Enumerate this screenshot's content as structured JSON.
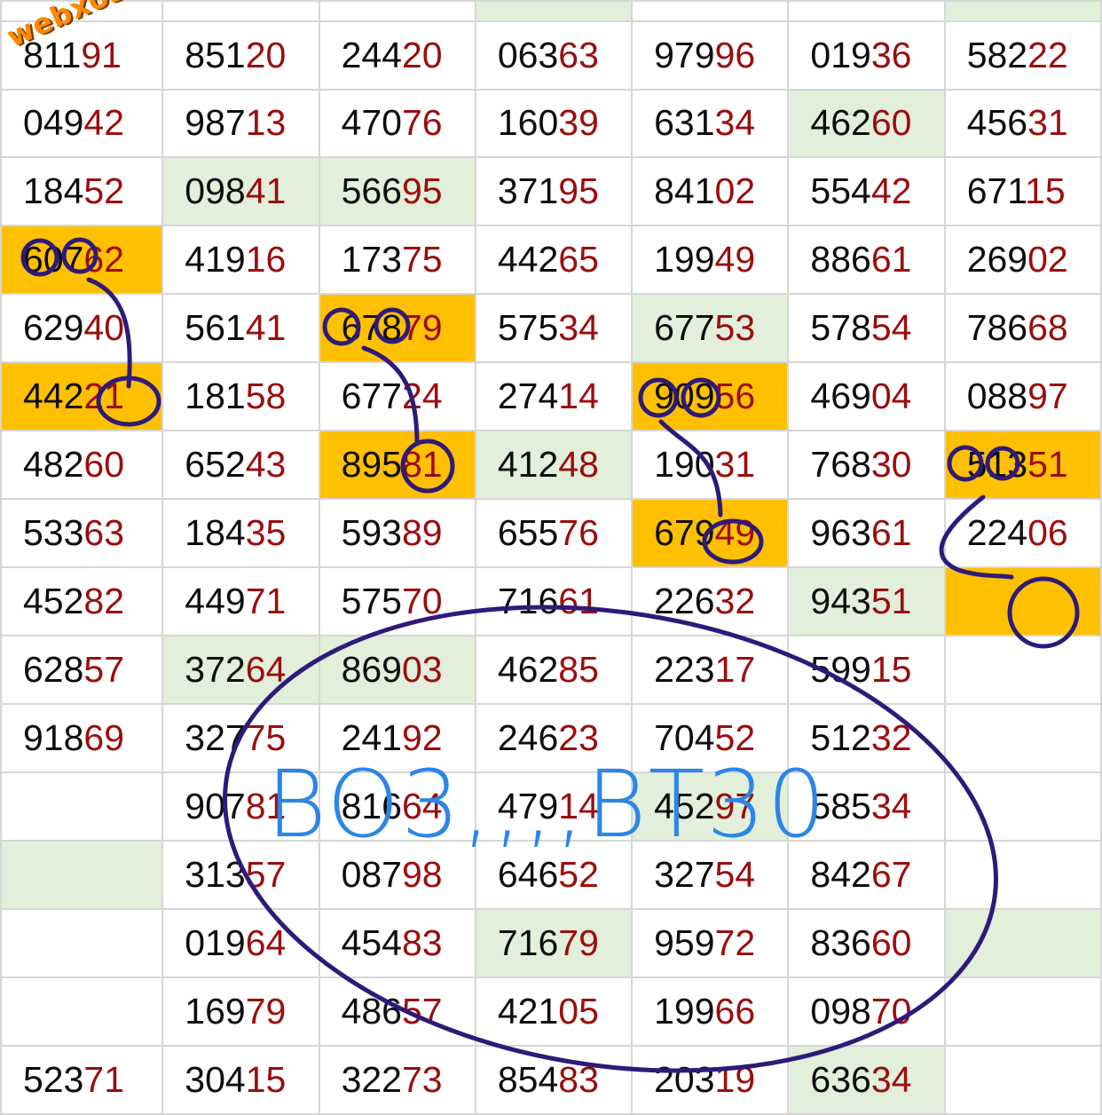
{
  "watermark": "webxoso.net",
  "handwritten_note": "BO3,,,,BT30",
  "colors": {
    "grid_line": "#d6d6d6",
    "digit_dark": "#0d0d0d",
    "digit_red": "#9b0d0d",
    "highlight_green": "#e2efda",
    "highlight_orange": "#ffc000",
    "ink": "#2e1a7a",
    "note_blue": "#2b86e8",
    "watermark": "#ff8a00"
  },
  "rows": [
    [
      {
        "v": "81191"
      },
      {
        "v": "85120"
      },
      {
        "v": "24420"
      },
      {
        "v": "06363"
      },
      {
        "v": "97996"
      },
      {
        "v": "01936"
      },
      {
        "v": "58222"
      }
    ],
    [
      {
        "v": "04942"
      },
      {
        "v": "98713"
      },
      {
        "v": "47076"
      },
      {
        "v": "16039"
      },
      {
        "v": "63134"
      },
      {
        "v": "46260",
        "bg": "green"
      },
      {
        "v": "45631"
      }
    ],
    [
      {
        "v": "18452"
      },
      {
        "v": "09841",
        "bg": "green"
      },
      {
        "v": "56695",
        "bg": "green"
      },
      {
        "v": "37195"
      },
      {
        "v": "84102"
      },
      {
        "v": "55442"
      },
      {
        "v": "67115"
      }
    ],
    [
      {
        "v": "60762",
        "bg": "orange"
      },
      {
        "v": "41916"
      },
      {
        "v": "17375"
      },
      {
        "v": "44265"
      },
      {
        "v": "19949"
      },
      {
        "v": "88661"
      },
      {
        "v": "26902"
      }
    ],
    [
      {
        "v": "62940"
      },
      {
        "v": "56141"
      },
      {
        "v": "67879",
        "bg": "orange"
      },
      {
        "v": "57534"
      },
      {
        "v": "67753",
        "bg": "green"
      },
      {
        "v": "57854"
      },
      {
        "v": "78668"
      }
    ],
    [
      {
        "v": "44221",
        "bg": "orange"
      },
      {
        "v": "18158"
      },
      {
        "v": "67724"
      },
      {
        "v": "27414"
      },
      {
        "v": "90956",
        "bg": "orange"
      },
      {
        "v": "46904"
      },
      {
        "v": "08897"
      }
    ],
    [
      {
        "v": "48260"
      },
      {
        "v": "65243"
      },
      {
        "v": "89581",
        "bg": "orange"
      },
      {
        "v": "41248",
        "bg": "green"
      },
      {
        "v": "19031"
      },
      {
        "v": "76830"
      },
      {
        "v": "51351",
        "bg": "orange"
      }
    ],
    [
      {
        "v": "53363"
      },
      {
        "v": "18435"
      },
      {
        "v": "59389"
      },
      {
        "v": "65576"
      },
      {
        "v": "67949",
        "bg": "orange"
      },
      {
        "v": "96361"
      },
      {
        "v": "22406"
      }
    ],
    [
      {
        "v": "45282"
      },
      {
        "v": "44971"
      },
      {
        "v": "57570"
      },
      {
        "v": "71661"
      },
      {
        "v": "22632"
      },
      {
        "v": "94351",
        "bg": "green"
      },
      {
        "v": "",
        "bg": "orange"
      }
    ],
    [
      {
        "v": "62857"
      },
      {
        "v": "37264",
        "bg": "green"
      },
      {
        "v": "86903",
        "bg": "green"
      },
      {
        "v": "46285"
      },
      {
        "v": "22317"
      },
      {
        "v": "59915"
      },
      {
        "v": ""
      }
    ],
    [
      {
        "v": "91869"
      },
      {
        "v": "32775"
      },
      {
        "v": "24192"
      },
      {
        "v": "24623"
      },
      {
        "v": "70452"
      },
      {
        "v": "51232"
      },
      {
        "v": ""
      }
    ],
    [
      {
        "v": ""
      },
      {
        "v": "90781"
      },
      {
        "v": "81664"
      },
      {
        "v": "47914"
      },
      {
        "v": "45297",
        "bg": "green"
      },
      {
        "v": "58534"
      },
      {
        "v": ""
      }
    ],
    [
      {
        "v": "",
        "bg": "green"
      },
      {
        "v": "31357"
      },
      {
        "v": "08798"
      },
      {
        "v": "64652"
      },
      {
        "v": "32754"
      },
      {
        "v": "84267"
      },
      {
        "v": ""
      }
    ],
    [
      {
        "v": ""
      },
      {
        "v": "01964"
      },
      {
        "v": "45483"
      },
      {
        "v": "71679",
        "bg": "green"
      },
      {
        "v": "95972"
      },
      {
        "v": "83660"
      },
      {
        "v": "",
        "bg": "green"
      }
    ],
    [
      {
        "v": ""
      },
      {
        "v": "16979"
      },
      {
        "v": "48657"
      },
      {
        "v": "42105"
      },
      {
        "v": "19966"
      },
      {
        "v": "09870"
      },
      {
        "v": ""
      }
    ],
    [
      {
        "v": "52371"
      },
      {
        "v": "30415"
      },
      {
        "v": "32273"
      },
      {
        "v": "85483"
      },
      {
        "v": "20319"
      },
      {
        "v": "63634",
        "bg": "green"
      },
      {
        "v": ""
      }
    ]
  ],
  "top_partial_row": [
    {
      "bg": ""
    },
    {
      "bg": ""
    },
    {
      "bg": ""
    },
    {
      "bg": "green"
    },
    {
      "bg": ""
    },
    {
      "bg": ""
    },
    {
      "bg": "green"
    }
  ]
}
